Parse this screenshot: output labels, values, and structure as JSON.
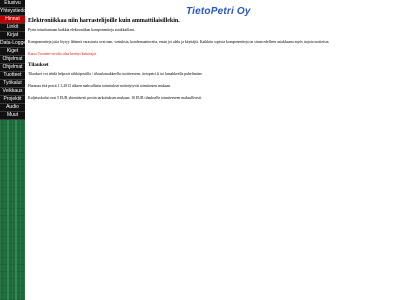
{
  "site": {
    "logo": "TietoPetri Oy"
  },
  "nav": {
    "items": [
      {
        "label": "Etusivu"
      },
      {
        "label": "Yhteystiedot"
      },
      {
        "label": "Hinnat"
      },
      {
        "label": "Linkit"
      },
      {
        "label": "Kirjat"
      },
      {
        "label": "Data-Loggeri"
      },
      {
        "label": "Kiget"
      },
      {
        "label": "Ohjelmat"
      },
      {
        "label": "Ohjelmat"
      },
      {
        "label": "Tuotteet"
      },
      {
        "label": "Työkalut"
      },
      {
        "label": "Veikkaus"
      },
      {
        "label": "Projektit"
      },
      {
        "label": "Audio"
      },
      {
        "label": "Muut"
      }
    ]
  },
  "content": {
    "heading": "Elektroniikkaa niin harrastelijoille kuin ammattilaisillekin.",
    "intro": "Pyrin toimittamaan kaikkia elektroniikan komponentteja asiakkaillani.",
    "body": "Komponentteja joita löytyy lähinnä varastosta ovat mm. vastuksia, kondensaattoreita, ensin joi alelu ja käyttäjiä. Kaikkiin sopivia komponentteja on sinun edelleen asiakkaana myös tarjota tuotteista.",
    "warning": "Katso Tuotteet-sivulta tilaa kerätyt kuluttajat.",
    "orders_heading": "Tilaukset",
    "orders": [
      "Tilaukset voi tehdä helposti sähköpostilla / tilauslomakkeella osoitteeseen, tietopetri.fi tai lomakkeella puhelimitse.",
      "Huomaa että postit 1.3.2013 alkaen maksullisiin toimitukset määräytyvät toimitusten mukaan.",
      "Kuljetuskulut ovat 5 EUR yhtenäisesti postin tarkoituksen mukaan. 10 EUR tilaukselle toimiteeseen maksullisesti."
    ]
  }
}
